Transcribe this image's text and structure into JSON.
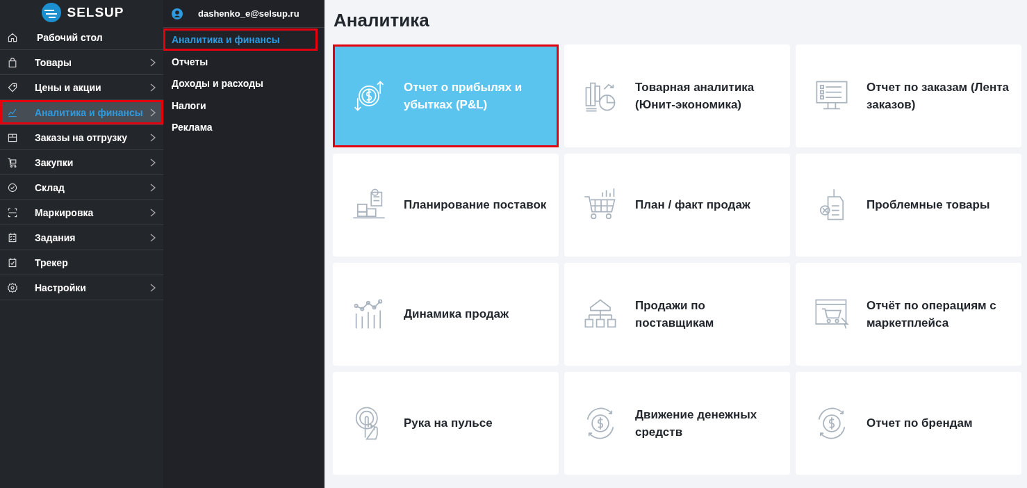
{
  "sidebar": {
    "logo": "SELSUP",
    "items": [
      {
        "label": "Рабочий стол",
        "has_submenu": false,
        "selected": false,
        "highlighted": false
      },
      {
        "label": "Товары",
        "has_submenu": true,
        "selected": false,
        "highlighted": false
      },
      {
        "label": "Цены и акции",
        "has_submenu": true,
        "selected": false,
        "highlighted": false
      },
      {
        "label": "Аналитика и финансы",
        "has_submenu": true,
        "selected": true,
        "highlighted": true
      },
      {
        "label": "Заказы на отгрузку",
        "has_submenu": true,
        "selected": false,
        "highlighted": false
      },
      {
        "label": "Закупки",
        "has_submenu": true,
        "selected": false,
        "highlighted": false
      },
      {
        "label": "Склад",
        "has_submenu": true,
        "selected": false,
        "highlighted": false
      },
      {
        "label": "Маркировка",
        "has_submenu": true,
        "selected": false,
        "highlighted": false
      },
      {
        "label": "Задания",
        "has_submenu": true,
        "selected": false,
        "highlighted": false
      },
      {
        "label": "Трекер",
        "has_submenu": false,
        "selected": false,
        "highlighted": false
      },
      {
        "label": "Настройки",
        "has_submenu": true,
        "selected": false,
        "highlighted": false
      }
    ]
  },
  "submenu": {
    "user": "dashenko_e@selsup.ru",
    "items": [
      {
        "label": "Аналитика и финансы",
        "selected": true,
        "highlighted": true
      },
      {
        "label": "Отчеты",
        "selected": false,
        "highlighted": false
      },
      {
        "label": "Доходы и расходы",
        "selected": false,
        "highlighted": false
      },
      {
        "label": "Налоги",
        "selected": false,
        "highlighted": false
      },
      {
        "label": "Реклама",
        "selected": false,
        "highlighted": false
      }
    ]
  },
  "main": {
    "title": "Аналитика",
    "cards": [
      {
        "label": "Отчет о прибылях и убытках (P&L)",
        "selected": true,
        "highlighted": true
      },
      {
        "label": "Товарная аналитика (Юнит-экономика)",
        "selected": false,
        "highlighted": false
      },
      {
        "label": "Отчет по заказам (Лента заказов)",
        "selected": false,
        "highlighted": false
      },
      {
        "label": "Планирование поставок",
        "selected": false,
        "highlighted": false
      },
      {
        "label": "План / факт продаж",
        "selected": false,
        "highlighted": false
      },
      {
        "label": "Проблемные товары",
        "selected": false,
        "highlighted": false
      },
      {
        "label": "Динамика продаж",
        "selected": false,
        "highlighted": false
      },
      {
        "label": "Продажи по поставщикам",
        "selected": false,
        "highlighted": false
      },
      {
        "label": "Отчёт по операциям с маркетплейса",
        "selected": false,
        "highlighted": false
      },
      {
        "label": "Рука на пульсе",
        "selected": false,
        "highlighted": false
      },
      {
        "label": "Движение денежных средств",
        "selected": false,
        "highlighted": false
      },
      {
        "label": "Отчет по брендам",
        "selected": false,
        "highlighted": false
      }
    ]
  }
}
